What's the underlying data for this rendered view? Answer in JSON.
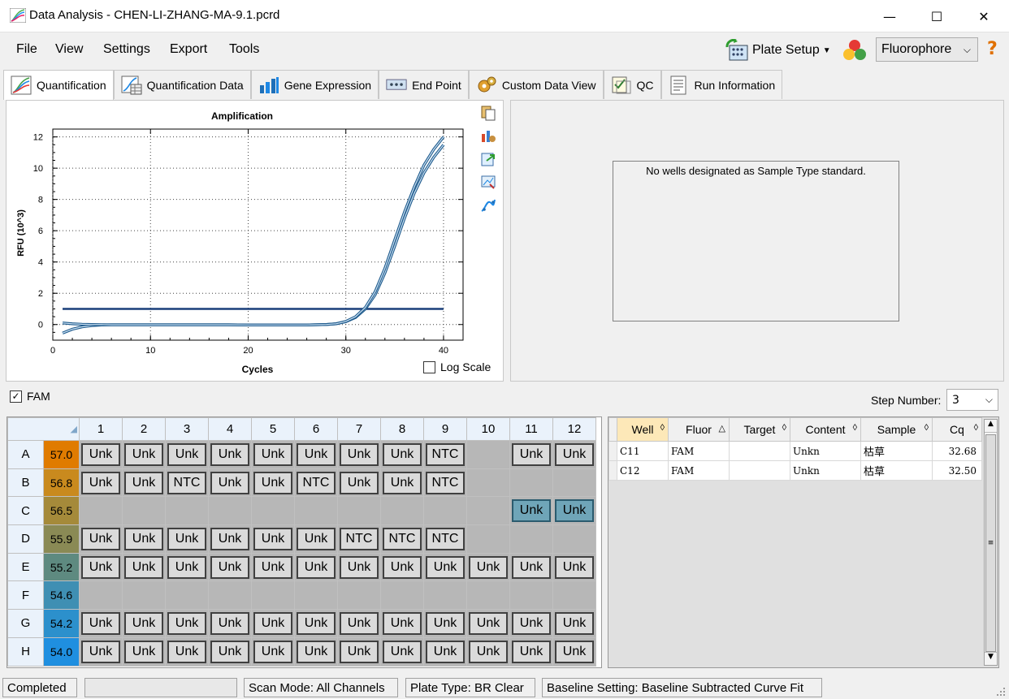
{
  "window": {
    "title": "Data Analysis - CHEN-LI-ZHANG-MA-9.1.pcrd",
    "minimize": "—",
    "maximize": "☐",
    "close": "✕"
  },
  "menu": [
    "File",
    "View",
    "Settings",
    "Export",
    "Tools"
  ],
  "toolbar": {
    "plate_setup_label": "Plate Setup",
    "fluorophore_value": "Fluorophore",
    "help": "?",
    "icons": [
      "plate-setup-icon",
      "traffic-light-icon"
    ]
  },
  "tabs": [
    {
      "label": "Quantification",
      "icon": "quantification-icon",
      "active": true
    },
    {
      "label": "Quantification Data",
      "icon": "quantification-data-icon"
    },
    {
      "label": "Gene Expression",
      "icon": "gene-expression-icon"
    },
    {
      "label": "End Point",
      "icon": "end-point-icon"
    },
    {
      "label": "Custom Data View",
      "icon": "custom-data-view-icon"
    },
    {
      "label": "QC",
      "icon": "qc-icon"
    },
    {
      "label": "Run Information",
      "icon": "run-information-icon"
    }
  ],
  "chart_data": {
    "type": "line",
    "title": "Amplification",
    "xlabel": "Cycles",
    "ylabel": "RFU (10^3)",
    "xlim": [
      0,
      42
    ],
    "ylim": [
      -1,
      12.5
    ],
    "xticks": [
      0,
      10,
      20,
      30,
      40
    ],
    "yticks": [
      0,
      2,
      4,
      6,
      8,
      10,
      12
    ],
    "grid": true,
    "log_scale": false,
    "threshold": 1.0,
    "series": [
      {
        "x": [
          1,
          2,
          3,
          4,
          5,
          6,
          8,
          10,
          12,
          14,
          16,
          18,
          20,
          22,
          24,
          26,
          28,
          29,
          30,
          31,
          32,
          33,
          34,
          35,
          36,
          37,
          38,
          39,
          40
        ],
        "y": [
          -0.55,
          -0.3,
          -0.15,
          -0.07,
          -0.03,
          -0.02,
          -0.02,
          -0.02,
          -0.02,
          -0.02,
          -0.02,
          -0.02,
          -0.03,
          -0.03,
          -0.03,
          -0.03,
          0.0,
          0.05,
          0.18,
          0.45,
          1.0,
          1.9,
          3.3,
          5.0,
          6.8,
          8.4,
          9.7,
          10.7,
          11.5
        ]
      },
      {
        "x": [
          1,
          2,
          3,
          4,
          5,
          6,
          8,
          10,
          12,
          14,
          16,
          18,
          20,
          22,
          24,
          26,
          28,
          29,
          30,
          31,
          32,
          33,
          34,
          35,
          36,
          37,
          38,
          39,
          40
        ],
        "y": [
          0.1,
          0.05,
          0.02,
          0.0,
          -0.01,
          -0.02,
          -0.02,
          -0.02,
          -0.02,
          -0.02,
          -0.02,
          -0.02,
          -0.03,
          -0.03,
          -0.03,
          -0.03,
          0.0,
          0.05,
          0.2,
          0.5,
          1.1,
          2.1,
          3.6,
          5.4,
          7.2,
          8.8,
          10.2,
          11.2,
          12.0
        ]
      }
    ]
  },
  "chart_panel": {
    "log_scale_label": "Log Scale",
    "side_icons": [
      "copy-icon",
      "chart-tools-icon",
      "export-icon",
      "zoom-icon",
      "curve-icon"
    ]
  },
  "standard_panel": {
    "message": "No wells designated as Sample Type standard."
  },
  "fluor_filter": {
    "label": "FAM",
    "checked": true
  },
  "step": {
    "label": "Step Number:",
    "value": "3"
  },
  "plate": {
    "columns": [
      "1",
      "2",
      "3",
      "4",
      "5",
      "6",
      "7",
      "8",
      "9",
      "10",
      "11",
      "12"
    ],
    "rows": [
      {
        "label": "A",
        "temp": "57.0",
        "temp_color": "#e07b00",
        "wells": [
          "Unk",
          "Unk",
          "Unk",
          "Unk",
          "Unk",
          "Unk",
          "Unk",
          "Unk",
          "NTC",
          "",
          "Unk",
          "Unk"
        ]
      },
      {
        "label": "B",
        "temp": "56.8",
        "temp_color": "#c98a1e",
        "wells": [
          "Unk",
          "Unk",
          "NTC",
          "Unk",
          "Unk",
          "NTC",
          "Unk",
          "Unk",
          "NTC",
          "",
          "",
          ""
        ]
      },
      {
        "label": "C",
        "temp": "56.5",
        "temp_color": "#a58a3a",
        "wells": [
          "",
          "",
          "",
          "",
          "",
          "",
          "",
          "",
          "",
          "",
          "Unk",
          "Unk"
        ],
        "selected": [
          10,
          11
        ]
      },
      {
        "label": "D",
        "temp": "55.9",
        "temp_color": "#8a8a55",
        "wells": [
          "Unk",
          "Unk",
          "Unk",
          "Unk",
          "Unk",
          "Unk",
          "NTC",
          "NTC",
          "NTC",
          "",
          "",
          ""
        ]
      },
      {
        "label": "E",
        "temp": "55.2",
        "temp_color": "#5e8a80",
        "wells": [
          "Unk",
          "Unk",
          "Unk",
          "Unk",
          "Unk",
          "Unk",
          "Unk",
          "Unk",
          "Unk",
          "Unk",
          "Unk",
          "Unk"
        ]
      },
      {
        "label": "F",
        "temp": "54.6",
        "temp_color": "#3f8fb3",
        "wells": [
          "",
          "",
          "",
          "",
          "",
          "",
          "",
          "",
          "",
          "",
          "",
          ""
        ]
      },
      {
        "label": "G",
        "temp": "54.2",
        "temp_color": "#2c90cc",
        "wells": [
          "Unk",
          "Unk",
          "Unk",
          "Unk",
          "Unk",
          "Unk",
          "Unk",
          "Unk",
          "Unk",
          "Unk",
          "Unk",
          "Unk"
        ]
      },
      {
        "label": "H",
        "temp": "54.0",
        "temp_color": "#1f8fe0",
        "wells": [
          "Unk",
          "Unk",
          "Unk",
          "Unk",
          "Unk",
          "Unk",
          "Unk",
          "Unk",
          "Unk",
          "Unk",
          "Unk",
          "Unk"
        ]
      }
    ]
  },
  "results_table": {
    "headers": [
      "Well",
      "Fluor",
      "Target",
      "Content",
      "Sample",
      "Cq"
    ],
    "rows": [
      [
        "C11",
        "FAM",
        "",
        "Unkn",
        "枯草",
        "32.68"
      ],
      [
        "C12",
        "FAM",
        "",
        "Unkn",
        "枯草",
        "32.50"
      ]
    ]
  },
  "status": {
    "state": "Completed",
    "scan_mode": "Scan Mode: All Channels",
    "plate_type": "Plate Type: BR Clear",
    "baseline": "Baseline Setting: Baseline Subtracted Curve Fit"
  }
}
